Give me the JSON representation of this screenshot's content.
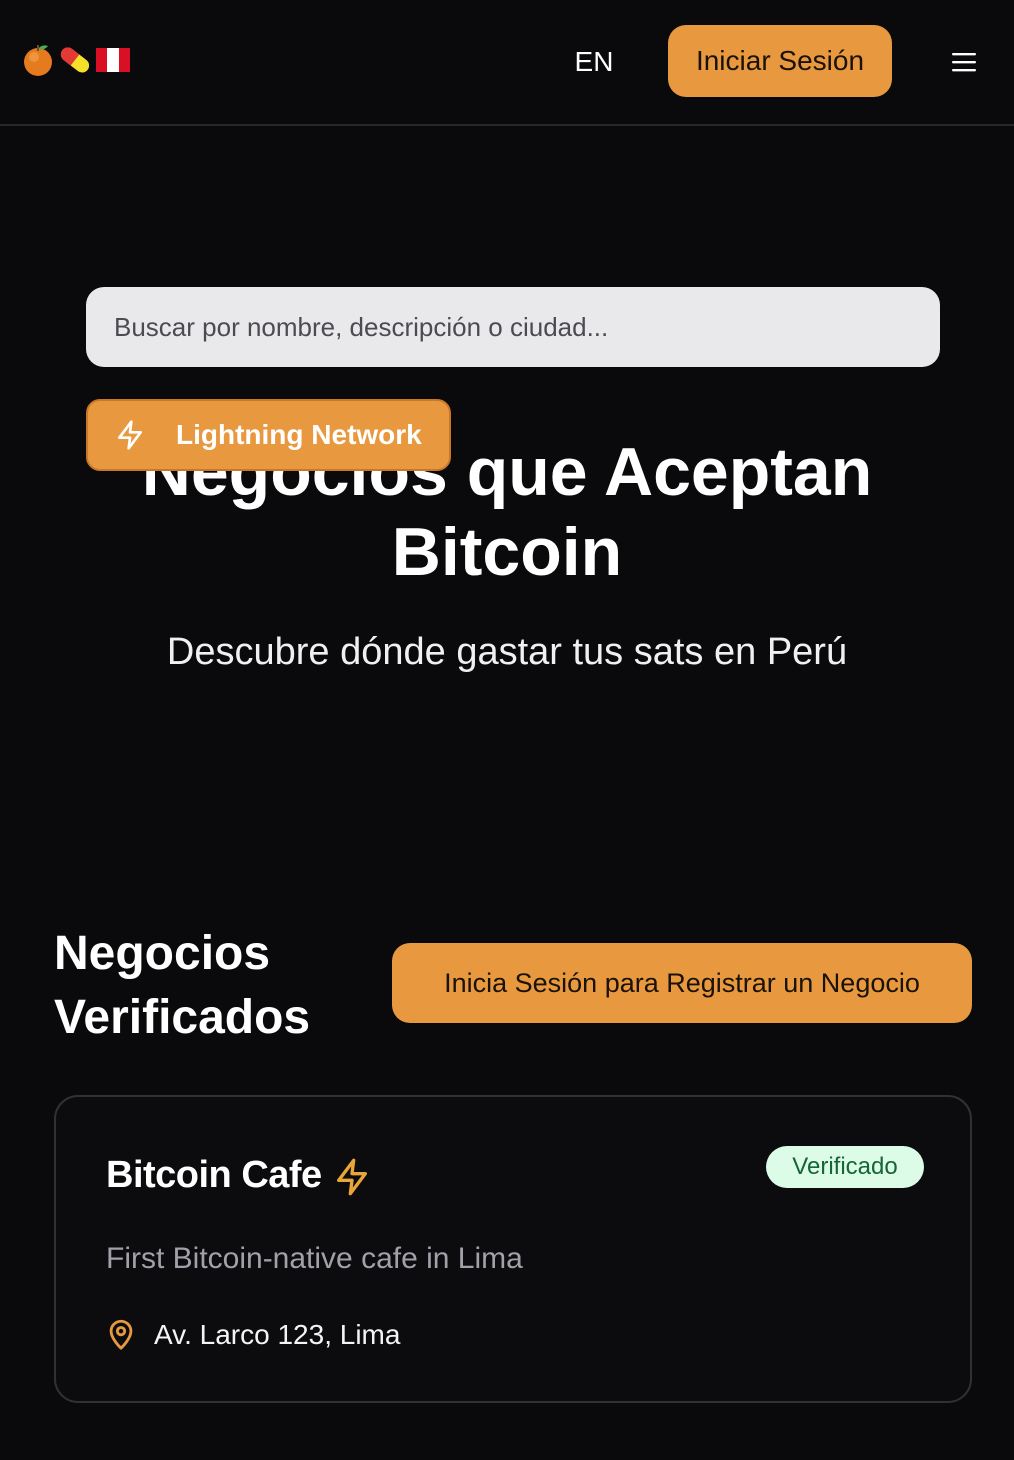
{
  "header": {
    "logo_icons": [
      "orange-icon",
      "pill-icon",
      "peru-flag-icon"
    ],
    "language_label": "EN",
    "login_label": "Iniciar Sesión",
    "menu_icon": "hamburger-menu-icon"
  },
  "search": {
    "placeholder": "Buscar por nombre, descripción o ciudad...",
    "value": ""
  },
  "hero": {
    "badge_label": "Lightning Network",
    "badge_icon": "lightning-bolt-icon",
    "title": "Negocios que Aceptan Bitcoin",
    "subtitle": "Descubre dónde gastar tus sats en Perú"
  },
  "section": {
    "title": "Negocios Verificados",
    "register_label": "Inicia Sesión para Registrar un Negocio"
  },
  "businesses": [
    {
      "name": "Bitcoin Cafe",
      "status": "Verificado",
      "description": "First Bitcoin-native cafe in Lima",
      "address": "Av. Larco 123, Lima",
      "lightning": true
    }
  ],
  "colors": {
    "background": "#0a0a0c",
    "accent": "#e8993f",
    "verified_bg": "#dcfce7",
    "verified_text": "#166534",
    "muted_text": "#a1a1aa"
  }
}
